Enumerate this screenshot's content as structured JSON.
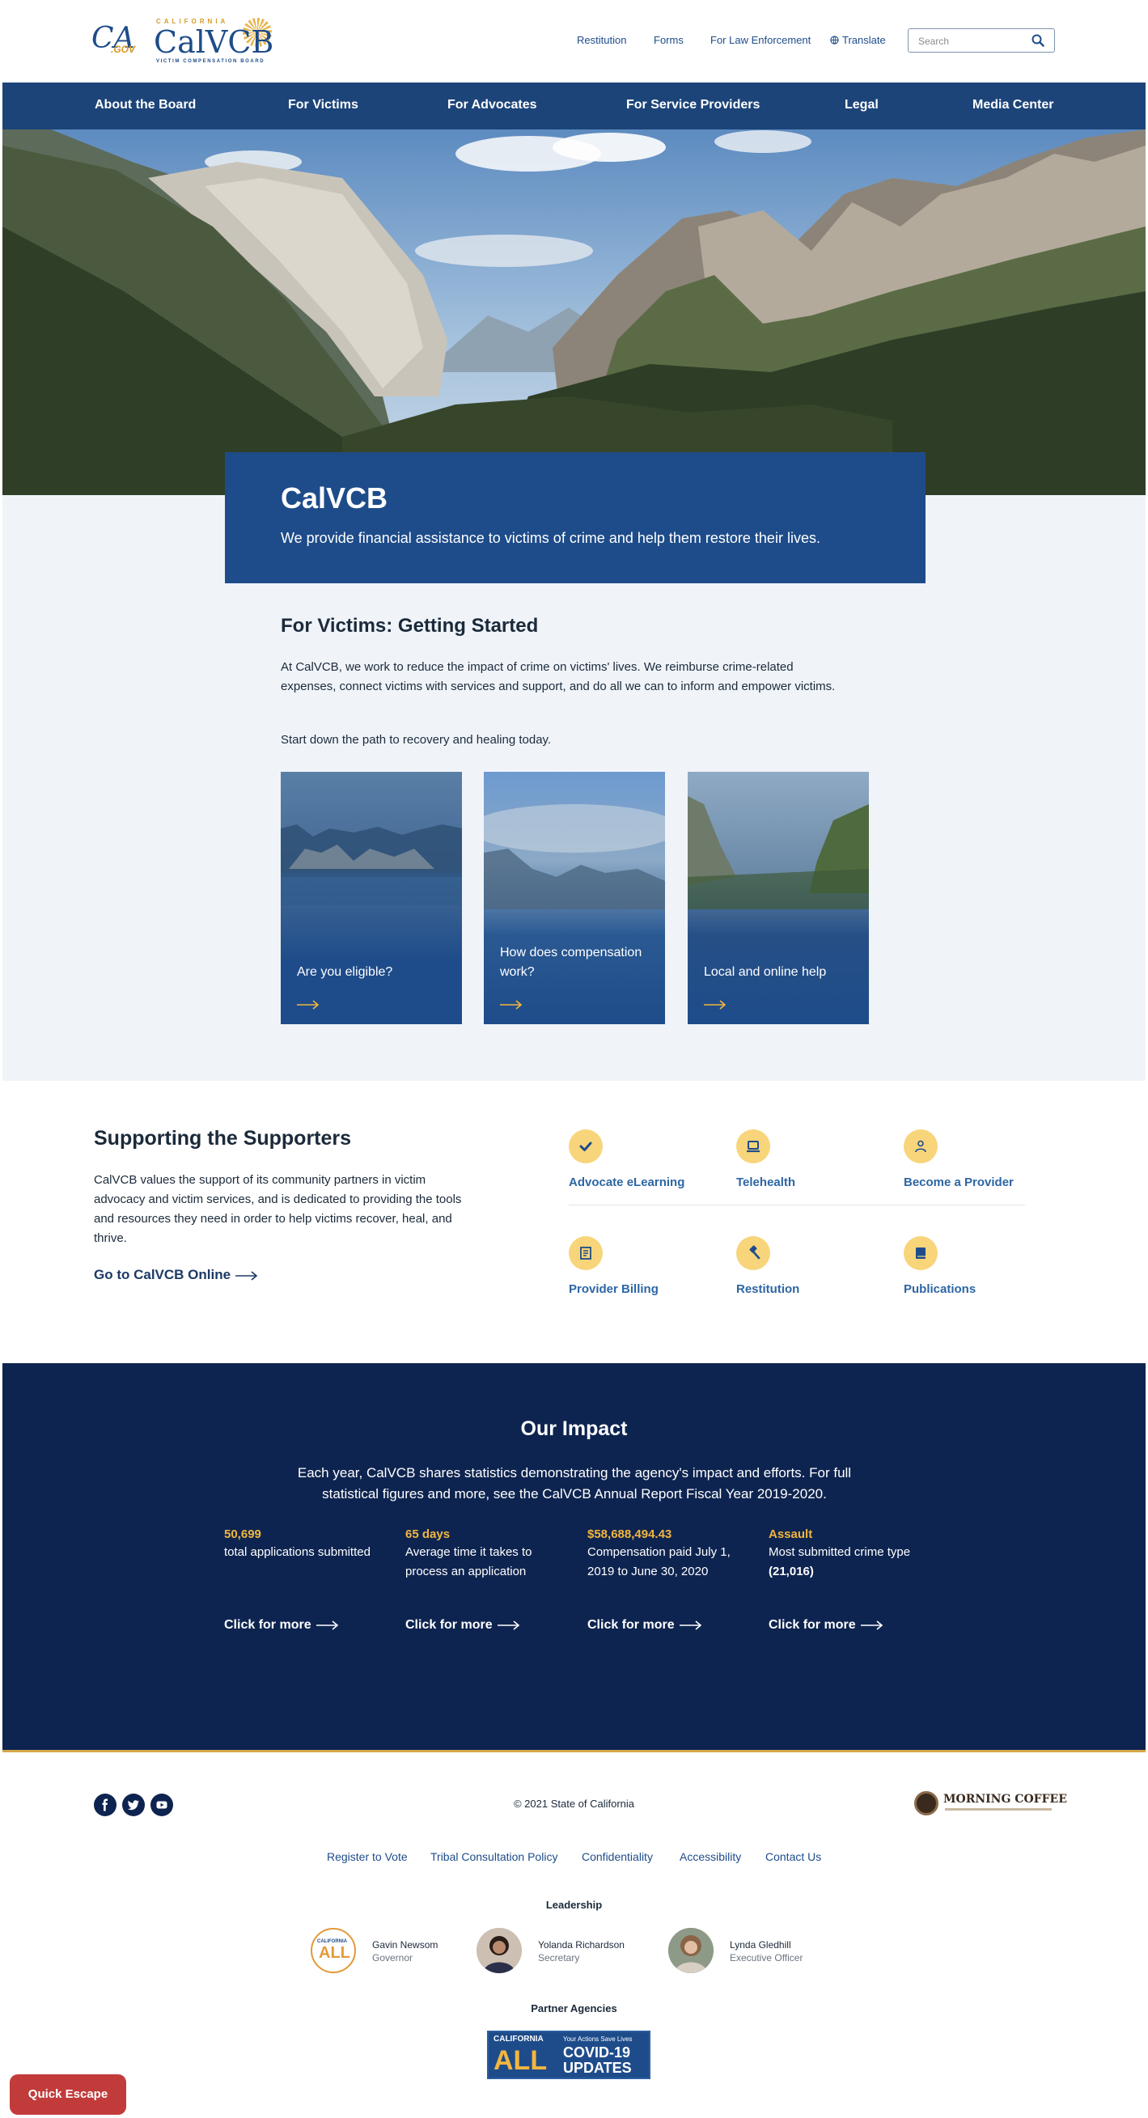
{
  "header": {
    "ca_gov": {
      "ca": "CA",
      "gov": ".GOV"
    },
    "brand": {
      "state": "CALIFORNIA",
      "name": "CalVCB",
      "sub": "VICTIM COMPENSATION BOARD"
    },
    "links": [
      "Restitution",
      "Forms",
      "For Law Enforcement",
      "Translate"
    ],
    "search_placeholder": "Search"
  },
  "nav": [
    "About the Board",
    "For Victims",
    "For Advocates",
    "For Service Providers",
    "Legal",
    "Media Center"
  ],
  "hero": {
    "title": "CalVCB",
    "subtitle": "We provide financial assistance to victims of crime and help them restore their lives."
  },
  "getting_started": {
    "title": "For Victims: Getting Started",
    "body": "At CalVCB, we work to reduce the impact of crime on victims' lives. We reimburse crime-related expenses, connect victims with services and support, and do all we can to inform and empower victims.",
    "body2": "Start down the path to recovery and healing today.",
    "cards": [
      "Are you eligible?",
      "How does compensation work?",
      "Local and online help"
    ]
  },
  "supporters": {
    "title": "Supporting the Supporters",
    "body": "CalVCB values the support of its community partners in victim advocacy and victim services, and is dedicated to providing the tools and resources they need in order to help victims recover, heal, and thrive.",
    "link": "Go to CalVCB Online",
    "services": [
      "Advocate eLearning",
      "Telehealth",
      "Become a Provider",
      "Provider Billing",
      "Restitution",
      "Publications"
    ]
  },
  "impact": {
    "title": "Our Impact",
    "text": "Each year, CalVCB shares statistics demonstrating the agency's impact and efforts. For full statistical figures and more, see the CalVCB Annual Report Fiscal Year 2019-2020.",
    "stats": [
      {
        "num": "50,699",
        "desc": "total applications submitted",
        "extra": ""
      },
      {
        "num": "65 days",
        "desc": "Average time it takes to process an application",
        "extra": ""
      },
      {
        "num": "$58,688,494.43",
        "desc": "Compensation paid July 1, 2019 to June 30, 2020",
        "extra": ""
      },
      {
        "num": "Assault",
        "desc": "Most submitted crime type",
        "extra": "(21,016)"
      }
    ],
    "more": "Click for more"
  },
  "footer": {
    "copyright": "© 2021 State of California",
    "morning_coffee": "MORNING COFFEE",
    "links": [
      "Register to Vote",
      "Tribal Consultation Policy",
      "Confidentiality",
      "Accessibility",
      "Contact Us"
    ],
    "leadership_title": "Leadership",
    "leaders": [
      {
        "name": "Gavin Newsom",
        "role": "Governor"
      },
      {
        "name": "Yolanda Richardson",
        "role": "Secretary"
      },
      {
        "name": "Lynda Gledhill",
        "role": "Executive Officer"
      }
    ],
    "badge": {
      "ca": "CALIFORNIA",
      "all": "ALL"
    },
    "partner_title": "Partner Agencies",
    "covid": {
      "ca": "CALIFORNIA",
      "all": "ALL",
      "small": "Your Actions Save Lives",
      "line1": "COVID-19",
      "line2": "UPDATES"
    }
  },
  "quick_escape": "Quick Escape",
  "colors": {
    "navy": "#1c4479",
    "dark_navy": "#0e2450",
    "gold": "#f2b63f",
    "link_blue": "#2d66a3",
    "escape_red": "#c23b3b"
  }
}
